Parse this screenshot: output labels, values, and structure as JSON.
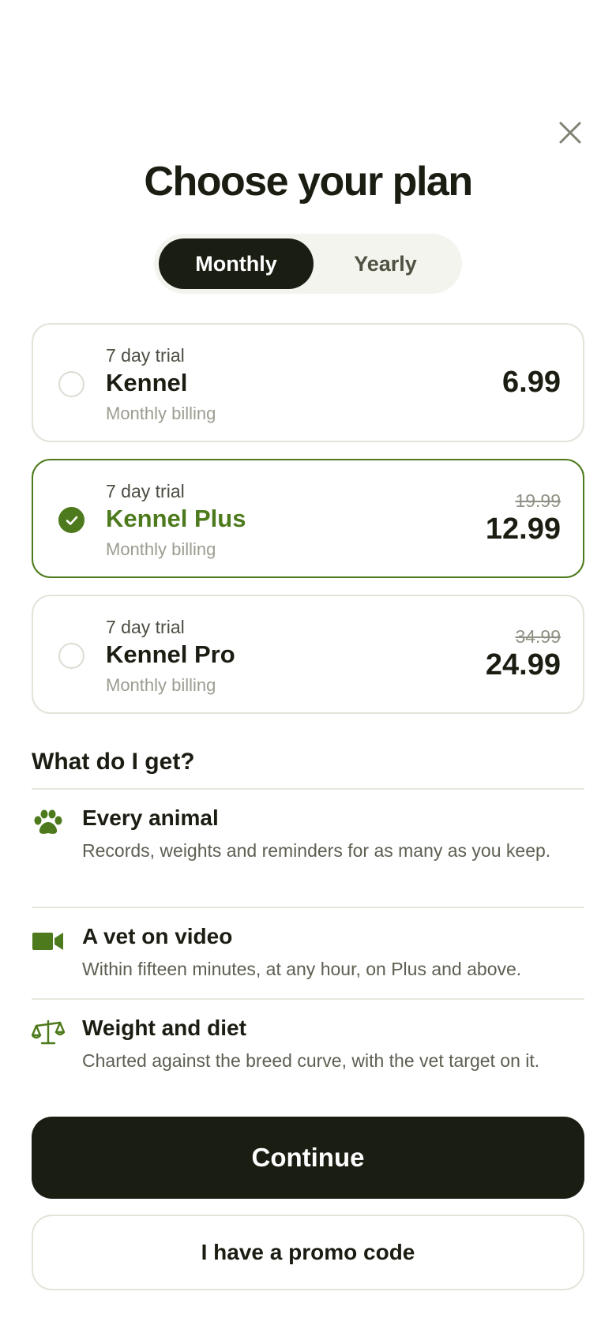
{
  "header": {
    "title": "Choose your plan",
    "close_icon": "close-icon"
  },
  "billing_toggle": {
    "options": [
      "Monthly",
      "Yearly"
    ],
    "selected": "Monthly"
  },
  "plans": [
    {
      "trial": "7 day trial",
      "name": "Kennel",
      "billing": "Monthly billing",
      "price": "6.99",
      "selected": false
    },
    {
      "trial": "7 day trial",
      "name": "Kennel Plus",
      "billing": "Monthly billing",
      "old_price": "19.99",
      "price": "12.99",
      "selected": true
    },
    {
      "trial": "7 day trial",
      "name": "Kennel Pro",
      "billing": "Monthly billing",
      "old_price": "34.99",
      "price": "24.99",
      "selected": false
    }
  ],
  "benefits": {
    "title": "What do I get?",
    "items": [
      {
        "icon": "paw-icon",
        "title": "Every animal",
        "description": "Records, weights and reminders for as many as you keep."
      },
      {
        "icon": "video-camera-icon",
        "title": "A vet on video",
        "description": "Within fifteen minutes, at any hour, on Plus and above."
      },
      {
        "icon": "scale-icon",
        "title": "Weight and diet",
        "description": "Charted against the breed curve, with the vet target on it."
      }
    ]
  },
  "actions": {
    "continue_label": "Continue",
    "promo_label": "I have a promo code"
  },
  "colors": {
    "accent": "#4d7a1c",
    "dark": "#1a1d12",
    "border": "#e3e3da"
  }
}
